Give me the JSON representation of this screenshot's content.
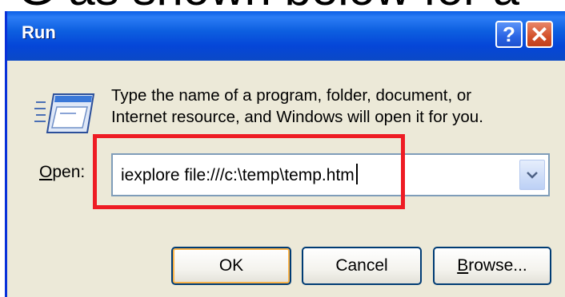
{
  "caption": "G as shown below for a",
  "window": {
    "title": "Run",
    "help_glyph": "?",
    "close_glyph": "✕"
  },
  "icons": {
    "run": "run-program-icon",
    "help": "help-icon",
    "close": "close-icon",
    "dropdown": "chevron-down-icon"
  },
  "dialog": {
    "description_line1": "Type the name of a program, folder, document, or",
    "description_line2": "Internet resource, and Windows will open it for you.",
    "open_label_mnemonic": "O",
    "open_label_rest": "pen:",
    "open_value": "iexplore file:///c:\\temp\\temp.htm"
  },
  "buttons": {
    "ok": "OK",
    "cancel": "Cancel",
    "browse_mnemonic": "B",
    "browse_rest": "rowse..."
  },
  "colors": {
    "titlebar": "#0546d8",
    "dialog_bg": "#ece9d8",
    "highlight": "#ee1c24",
    "button_border": "#003c74"
  }
}
